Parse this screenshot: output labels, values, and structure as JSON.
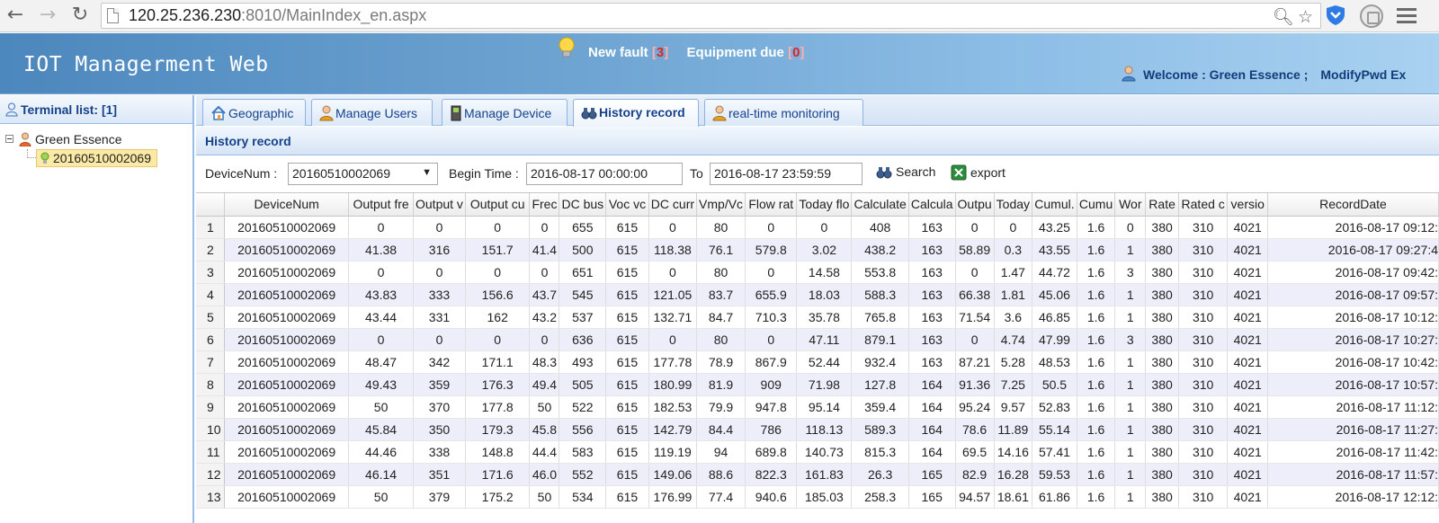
{
  "browser": {
    "url_host": "120.25.236.230",
    "url_rest": ":8010/MainIndex_en.aspx"
  },
  "header": {
    "title": "IOT Managerment Web",
    "new_fault_label": "New fault",
    "new_fault_count": "3",
    "equipment_due_label": "Equipment due",
    "equipment_due_count": "0",
    "welcome": "Welcome : Green Essence ;",
    "modify_pwd": "ModifyPwd",
    "exit": "Ex"
  },
  "sidebar": {
    "title": "Terminal list: [1]",
    "root": "Green Essence",
    "child": "20160510002069"
  },
  "tabs": [
    {
      "label": "Geographic"
    },
    {
      "label": "Manage Users"
    },
    {
      "label": "Manage Device"
    },
    {
      "label": "History record"
    },
    {
      "label": "real-time monitoring"
    }
  ],
  "panel": {
    "title": "History record"
  },
  "filters": {
    "device_label": "DeviceNum :",
    "device_value": "20160510002069",
    "begin_label": "Begin Time :",
    "begin_value": "2016-08-17 00:00:00",
    "to_label": "To",
    "to_value": "2016-08-17 23:59:59",
    "search_label": "Search",
    "export_label": "export"
  },
  "grid": {
    "columns": [
      "",
      "DeviceNum",
      "Output fre",
      "Output v",
      "Output cu",
      "Frec",
      "DC bus",
      "Voc vc",
      "DC curr",
      "Vmp/Vc",
      "Flow rat",
      "Today flo",
      "Calculate",
      "Calcula",
      "Outpu",
      "Today",
      "Cumul.",
      "Cumu",
      "Wor",
      "Rate",
      "Rated c",
      "versio",
      "RecordDate"
    ],
    "rows": [
      [
        "1",
        "20160510002069",
        "0",
        "0",
        "0",
        "0",
        "655",
        "615",
        "0",
        "80",
        "0",
        "0",
        "408",
        "163",
        "0",
        "0",
        "43.25",
        "1.6",
        "0",
        "380",
        "310",
        "4021",
        "2016-08-17 09:12:"
      ],
      [
        "2",
        "20160510002069",
        "41.38",
        "316",
        "151.7",
        "41.4",
        "500",
        "615",
        "118.38",
        "76.1",
        "579.8",
        "3.02",
        "438.2",
        "163",
        "58.89",
        "0.3",
        "43.55",
        "1.6",
        "1",
        "380",
        "310",
        "4021",
        "2016-08-17 09:27:4"
      ],
      [
        "3",
        "20160510002069",
        "0",
        "0",
        "0",
        "0",
        "651",
        "615",
        "0",
        "80",
        "0",
        "14.58",
        "553.8",
        "163",
        "0",
        "1.47",
        "44.72",
        "1.6",
        "3",
        "380",
        "310",
        "4021",
        "2016-08-17 09:42:"
      ],
      [
        "4",
        "20160510002069",
        "43.83",
        "333",
        "156.6",
        "43.7",
        "545",
        "615",
        "121.05",
        "83.7",
        "655.9",
        "18.03",
        "588.3",
        "163",
        "66.38",
        "1.81",
        "45.06",
        "1.6",
        "1",
        "380",
        "310",
        "4021",
        "2016-08-17 09:57:"
      ],
      [
        "5",
        "20160510002069",
        "43.44",
        "331",
        "162",
        "43.2",
        "537",
        "615",
        "132.71",
        "84.7",
        "710.3",
        "35.78",
        "765.8",
        "163",
        "71.54",
        "3.6",
        "46.85",
        "1.6",
        "1",
        "380",
        "310",
        "4021",
        "2016-08-17 10:12:"
      ],
      [
        "6",
        "20160510002069",
        "0",
        "0",
        "0",
        "0",
        "636",
        "615",
        "0",
        "80",
        "0",
        "47.11",
        "879.1",
        "163",
        "0",
        "4.74",
        "47.99",
        "1.6",
        "3",
        "380",
        "310",
        "4021",
        "2016-08-17 10:27:"
      ],
      [
        "7",
        "20160510002069",
        "48.47",
        "342",
        "171.1",
        "48.3",
        "493",
        "615",
        "177.78",
        "78.9",
        "867.9",
        "52.44",
        "932.4",
        "163",
        "87.21",
        "5.28",
        "48.53",
        "1.6",
        "1",
        "380",
        "310",
        "4021",
        "2016-08-17 10:42:"
      ],
      [
        "8",
        "20160510002069",
        "49.43",
        "359",
        "176.3",
        "49.4",
        "505",
        "615",
        "180.99",
        "81.9",
        "909",
        "71.98",
        "127.8",
        "164",
        "91.36",
        "7.25",
        "50.5",
        "1.6",
        "1",
        "380",
        "310",
        "4021",
        "2016-08-17 10:57:"
      ],
      [
        "9",
        "20160510002069",
        "50",
        "370",
        "177.8",
        "50",
        "522",
        "615",
        "182.53",
        "79.9",
        "947.8",
        "95.14",
        "359.4",
        "164",
        "95.24",
        "9.57",
        "52.83",
        "1.6",
        "1",
        "380",
        "310",
        "4021",
        "2016-08-17 11:12:"
      ],
      [
        "10",
        "20160510002069",
        "45.84",
        "350",
        "179.3",
        "45.8",
        "556",
        "615",
        "142.79",
        "84.4",
        "786",
        "118.13",
        "589.3",
        "164",
        "78.6",
        "11.89",
        "55.14",
        "1.6",
        "1",
        "380",
        "310",
        "4021",
        "2016-08-17 11:27:"
      ],
      [
        "11",
        "20160510002069",
        "44.46",
        "338",
        "148.8",
        "44.4",
        "583",
        "615",
        "119.19",
        "94",
        "689.8",
        "140.73",
        "815.3",
        "164",
        "69.5",
        "14.16",
        "57.41",
        "1.6",
        "1",
        "380",
        "310",
        "4021",
        "2016-08-17 11:42:"
      ],
      [
        "12",
        "20160510002069",
        "46.14",
        "351",
        "171.6",
        "46.0",
        "552",
        "615",
        "149.06",
        "88.6",
        "822.3",
        "161.83",
        "26.3",
        "165",
        "82.9",
        "16.28",
        "59.53",
        "1.6",
        "1",
        "380",
        "310",
        "4021",
        "2016-08-17 11:57:"
      ],
      [
        "13",
        "20160510002069",
        "50",
        "379",
        "175.2",
        "50",
        "534",
        "615",
        "176.99",
        "77.4",
        "940.6",
        "185.03",
        "258.3",
        "165",
        "94.57",
        "18.61",
        "61.86",
        "1.6",
        "1",
        "380",
        "310",
        "4021",
        "2016-08-17 12:12:"
      ]
    ]
  }
}
